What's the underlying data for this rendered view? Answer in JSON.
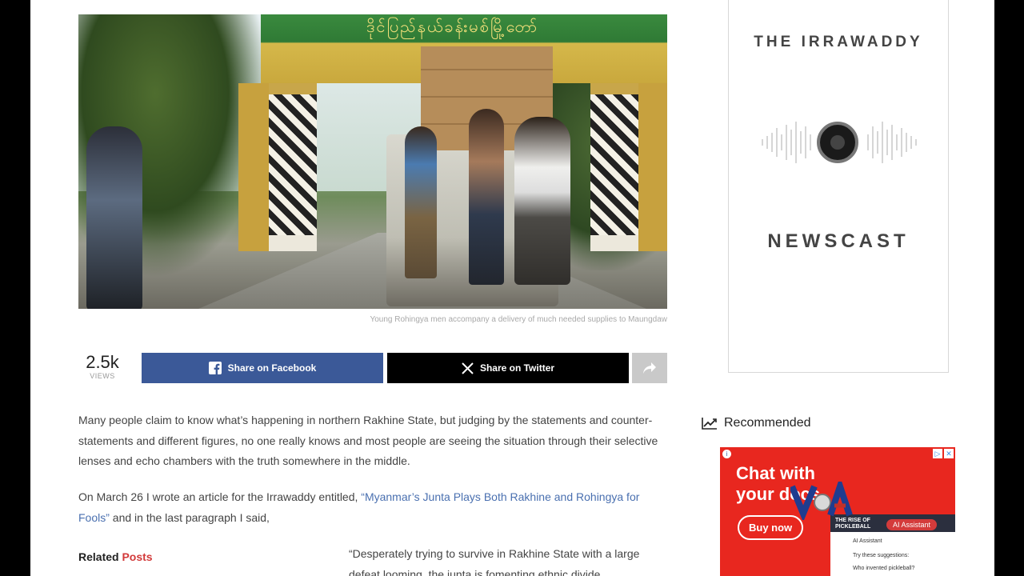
{
  "article": {
    "photo_caption": "Young Rohingya men accompany a delivery of much needed supplies to Maungdaw",
    "gate_text": "ဒိုင်ပြည်နယ်ခန်းမစ်မြို့တော်",
    "views_count": "2.5k",
    "views_label": "VIEWS",
    "share_facebook": "Share on Facebook",
    "share_twitter": "Share on Twitter",
    "paragraph_1": "Many people claim to know what’s happening in northern Rakhine State, but judging by the statements and counter-statements and different figures, no one really knows and most people are seeing the situation through their selective lenses and echo chambers with the truth somewhere in the middle.",
    "paragraph_2_prefix": "On March 26 I wrote an article for the Irrawaddy entitled, ",
    "paragraph_2_link": "“Myanmar’s Junta Plays Both Rakhine and Rohingya for Fools”",
    "paragraph_2_suffix": " and in the last paragraph I said,",
    "quote": "“Desperately trying to survive in Rakhine State with a large defeat looming, the junta is fomenting ethnic divide",
    "related_prefix": "Related ",
    "related_highlight": "Posts"
  },
  "sidebar": {
    "ad_brand": "THE IRRAWADDY",
    "ad_title": "NEWSCAST",
    "recommended_label": "Recommended",
    "promo": {
      "headline_1": "Chat with",
      "headline_2": "your docs.",
      "cta": "Buy now",
      "screenshot_title": "THE RISE OF PICKLEBALL",
      "assistant_tag": "AI Assistant",
      "line_1": "AI Assistant",
      "line_2": "Try these suggestions:",
      "line_3": "Who invented pickleball?"
    }
  },
  "colors": {
    "facebook": "#3b5998",
    "twitter": "#000000",
    "link": "#4a70b0",
    "related_accent": "#d23a3a",
    "promo_bg": "#e8271f"
  },
  "icons": [
    "facebook-icon",
    "x-icon",
    "share-arrow-icon",
    "speaker-icon",
    "trend-chart-icon",
    "voa-logo-icon",
    "ad-info-icon",
    "ad-close-icon"
  ]
}
